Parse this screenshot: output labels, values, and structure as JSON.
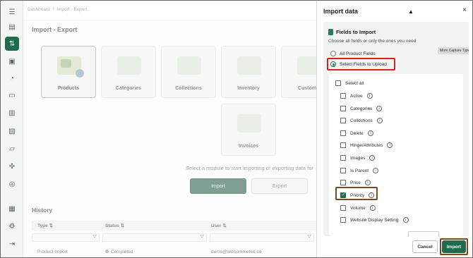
{
  "breadcrumb": {
    "home": "Dashboard",
    "separator": "/",
    "current": "Import - Export"
  },
  "page": {
    "title": "Import - Export"
  },
  "modules": [
    {
      "label": "Products"
    },
    {
      "label": "Categories"
    },
    {
      "label": "Collections"
    },
    {
      "label": "Inventory"
    },
    {
      "label": "Custome"
    },
    {
      "label": "Invoices"
    }
  ],
  "module_hint": "Select a module to start importing or exporting data for",
  "main_buttons": {
    "import": "Import",
    "export": "Export"
  },
  "history": {
    "title": "History",
    "columns": [
      "Type",
      "Status",
      "User"
    ],
    "rows": [
      {
        "type": "Product Import",
        "status": "Completed",
        "user": "demo@wizcommerce.co"
      }
    ]
  },
  "drawer": {
    "title": "Import data",
    "close_icon": "×",
    "section_title": "Fields to Import",
    "section_sub": "Choose all fields or only the ones you need",
    "more_capture": "More Capture Types.",
    "radio_all": "All Product Fields",
    "radio_select": "Select Fields to Upload",
    "select_all": "Select all",
    "fields": [
      {
        "label": "Active",
        "checked": false
      },
      {
        "label": "Categories",
        "checked": false
      },
      {
        "label": "Collections",
        "checked": false
      },
      {
        "label": "Delete",
        "checked": false
      },
      {
        "label": "Hinge/Attributes",
        "checked": false
      },
      {
        "label": "Images",
        "checked": false
      },
      {
        "label": "Is Parent",
        "checked": false
      },
      {
        "label": "Price",
        "checked": false
      },
      {
        "label": "Priority",
        "checked": true
      },
      {
        "label": "Volume",
        "checked": false
      },
      {
        "label": "Website Display Setting",
        "checked": false
      }
    ],
    "cancel": "Cancel",
    "import": "Import"
  },
  "colors": {
    "brand": "#1f6b4d",
    "highlight_red": "#d32222",
    "highlight_brown": "#7a4a1e"
  }
}
